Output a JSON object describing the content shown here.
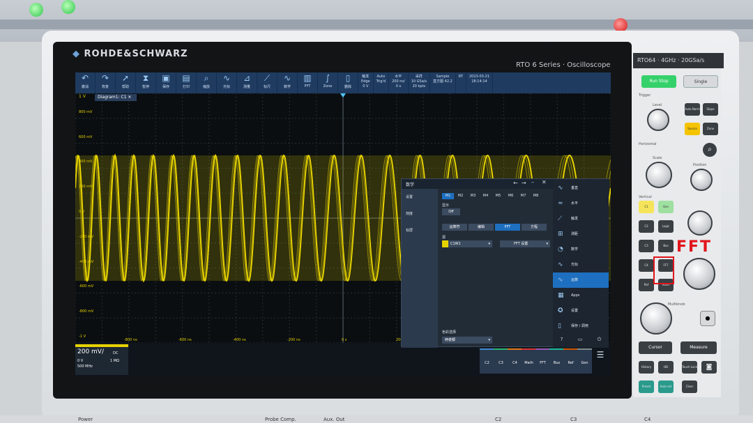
{
  "instrument": {
    "brand": "ROHDE&SCHWARZ",
    "series": "RTO 6 Series",
    "type": "Oscilloscope",
    "model_header": "RTO64 · 4GHz · 20GSa/s"
  },
  "toolbar": {
    "items": [
      {
        "icon": "undo-icon",
        "label": "撤消"
      },
      {
        "icon": "redo-icon",
        "label": "恢复"
      },
      {
        "icon": "pointer-icon",
        "label": "帮助"
      },
      {
        "icon": "hourglass-icon",
        "label": "暂停"
      },
      {
        "icon": "save-icon",
        "label": "保存"
      },
      {
        "icon": "print-icon",
        "label": "打印"
      },
      {
        "icon": "zoom-icon",
        "label": "缩放"
      },
      {
        "icon": "cursor-icon",
        "label": "光标"
      },
      {
        "icon": "measure-icon",
        "label": "测量"
      },
      {
        "icon": "ruler-icon",
        "label": "标尺"
      },
      {
        "icon": "wave-icon",
        "label": "数学"
      },
      {
        "icon": "fft-icon",
        "label": "FFT"
      },
      {
        "icon": "zone-icon",
        "label": "Zone"
      },
      {
        "icon": "trash-icon",
        "label": "删除"
      }
    ],
    "status": [
      {
        "l1": "触发",
        "l2": "Edge",
        "l3": "0 V"
      },
      {
        "l1": "",
        "l2": "Auto",
        "l3": "Trig'd"
      },
      {
        "l1": "水平",
        "l2": "200 ns/",
        "l3": "0 s"
      },
      {
        "l1": "采样",
        "l2": "10 GSa/s",
        "l3": "20 kpts"
      },
      {
        "l1": "",
        "l2": "Sample",
        "l3": "直方图 42.2"
      },
      {
        "l1": "",
        "l2": "RT",
        "l3": ""
      },
      {
        "l1": "2023-03-21",
        "l2": "18:14:14",
        "l3": ""
      }
    ]
  },
  "plot": {
    "tab": "Diagram1: C1 ✕",
    "scale_label": "1 V",
    "y_labels": [
      "800 mV",
      "600 mV",
      "400 mV",
      "200 mV",
      "0 V",
      "-200 mV",
      "-400 mV",
      "-600 mV",
      "-800 mV",
      "-1 V"
    ],
    "x_labels": [
      "-800 ns",
      "-600 ns",
      "-400 ns",
      "-200 ns",
      "0 s",
      "200"
    ],
    "trace_color": "#e6d200"
  },
  "channel_panel": {
    "label": "C1",
    "scale": "200 mV/",
    "coupling": "DC",
    "offset": "0 V",
    "impedance": "1 MΩ",
    "bandwidth": "500 MHz"
  },
  "bottom_buttons": [
    "C2",
    "C3",
    "C4",
    "Math",
    "FFT",
    "Bus",
    "Ref",
    "Gen"
  ],
  "dialog": {
    "title": "数学",
    "left_items": [
      "设置",
      "刻度",
      "标屏"
    ],
    "tabs": [
      "M1",
      "M2",
      "M3",
      "M4",
      "M5",
      "M6",
      "M7",
      "M8"
    ],
    "display_label": "显示",
    "display_toggle": "Off",
    "mode_tabs": [
      "运算符",
      "编辑",
      "FFT",
      "方程"
    ],
    "source_label": "源",
    "source_value": "C1W1",
    "fft_setting": "FFT 设置",
    "color_label": "色彩选择",
    "color_value": "两者都",
    "right_items": [
      {
        "icon": "vertical-icon",
        "label": "垂直"
      },
      {
        "icon": "horizontal-icon",
        "label": "水平"
      },
      {
        "icon": "trigger-icon",
        "label": "触发"
      },
      {
        "icon": "grid-icon",
        "label": "测距"
      },
      {
        "icon": "analyze-icon",
        "label": "数学"
      },
      {
        "icon": "cursor-icon",
        "label": "光标"
      },
      {
        "icon": "math-icon",
        "label": "运算"
      },
      {
        "icon": "apps-icon",
        "label": "Apps"
      },
      {
        "icon": "settings-icon",
        "label": "设置"
      },
      {
        "icon": "file-icon",
        "label": "保存 / 调用"
      }
    ]
  },
  "front_panel": {
    "run_stop": "Run Stop",
    "single": "Single",
    "trigger_label": "Trigger",
    "level_label": "Level",
    "auto_norm": "Auto Norm",
    "slope": "Slope",
    "source": "Source",
    "zone": "Zone",
    "horizontal_label": "Horizontal",
    "scale_label": "Scale",
    "position_label": "Position",
    "vertical_label": "Vertical",
    "ch_buttons": [
      "C1",
      "C2",
      "C3",
      "C4",
      "Ref"
    ],
    "logic": "Logic",
    "bus": "Bus",
    "fft": "FFT",
    "math": "Math",
    "gen": "Gen",
    "multiknob_label": "Multiknob",
    "cursor": "Cursor",
    "measure": "Measure",
    "history": "History",
    "hd": "HD",
    "touch_lock": "Touch Lock",
    "preset": "Preset",
    "autoset": "Auto set",
    "clear": "Clear",
    "fft_callout": "FFT"
  },
  "bottom_labels": [
    "Power",
    "Probe Comp.",
    "Aux. Out",
    "C2",
    "C3",
    "C4"
  ]
}
